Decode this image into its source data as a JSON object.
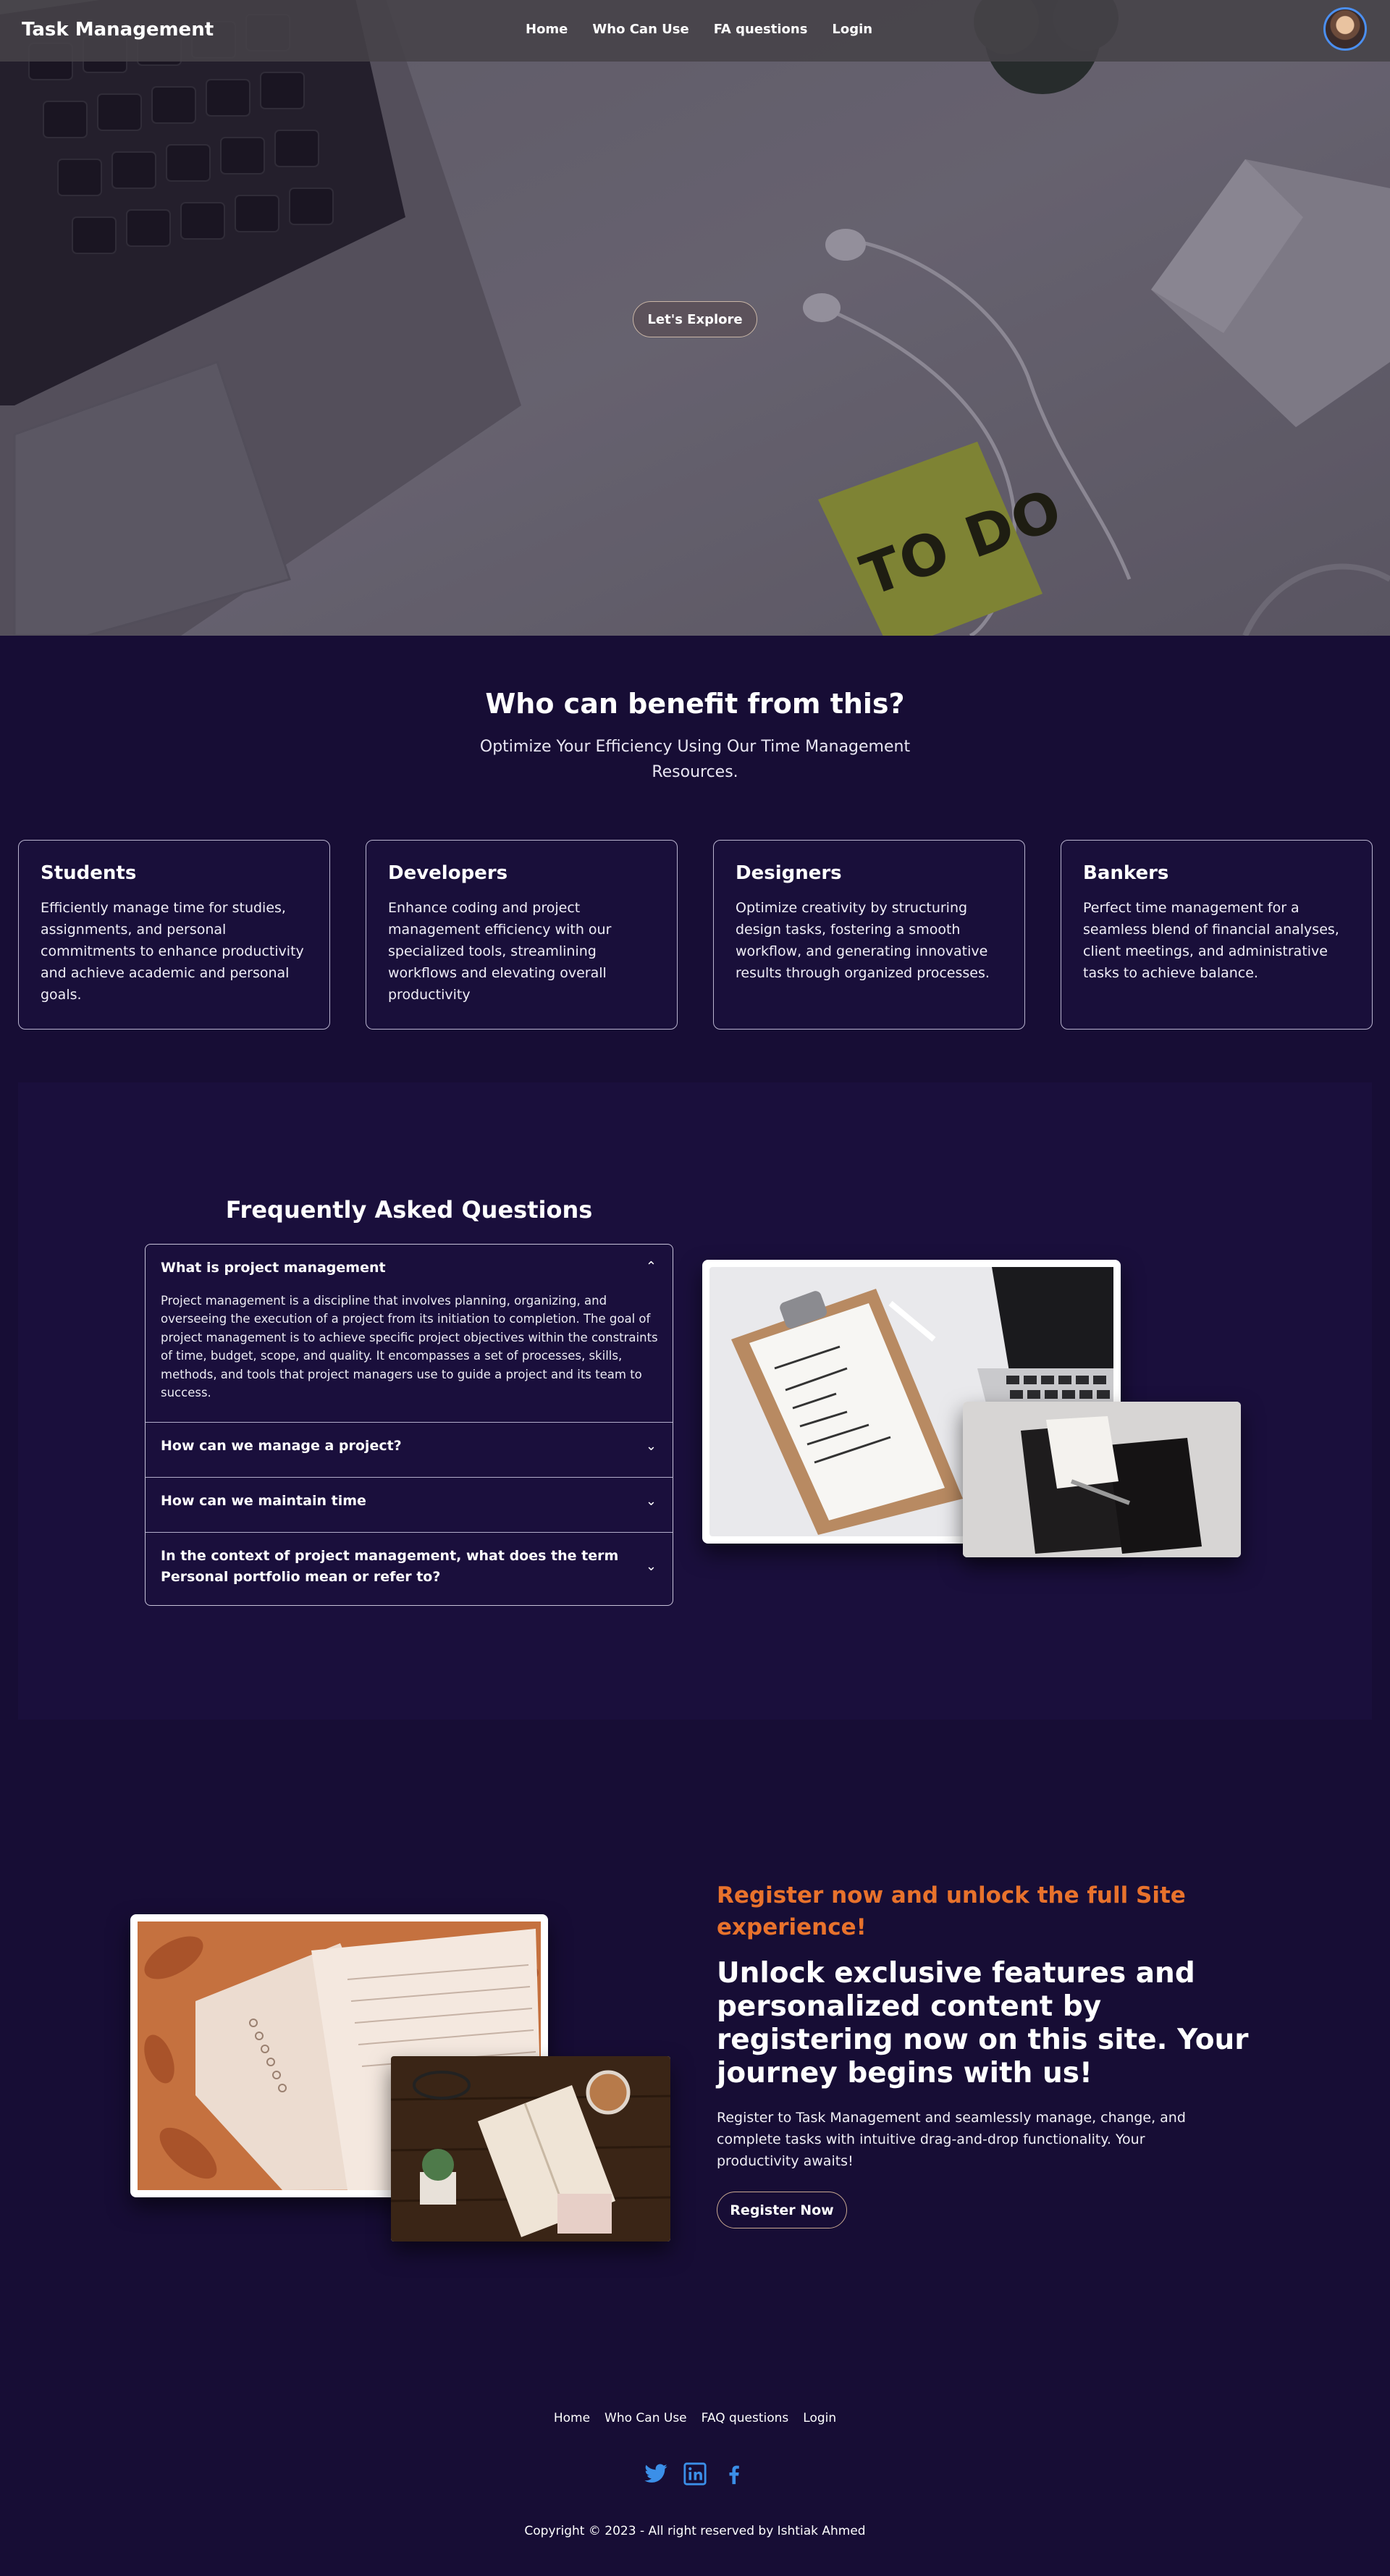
{
  "nav": {
    "brand": "Task Management",
    "links": [
      "Home",
      "Who Can Use",
      "FA questions",
      "Login"
    ]
  },
  "hero": {
    "explore_label": "Let's Explore",
    "sticky_note_text": "TO DO"
  },
  "benefits": {
    "title": "Who can benefit from this?",
    "subtitle": "Optimize Your Efficiency Using Our Time Management Resources.",
    "cards": [
      {
        "title": "Students",
        "text": "Efficiently manage time for studies, assignments, and personal commitments to enhance productivity and achieve academic and personal goals."
      },
      {
        "title": "Developers",
        "text": "Enhance coding and project management efficiency with our specialized tools, streamlining workflows and elevating overall productivity"
      },
      {
        "title": "Designers",
        "text": "Optimize creativity by structuring design tasks, fostering a smooth workflow, and generating innovative results through organized processes."
      },
      {
        "title": "Bankers",
        "text": "Perfect time management for a seamless blend of financial analyses, client meetings, and administrative tasks to achieve balance."
      }
    ]
  },
  "faq": {
    "title": "Frequently Asked Questions",
    "items": [
      {
        "q": "What is project management",
        "a": "Project management is a discipline that involves planning, organizing, and overseeing the execution of a project from its initiation to completion. The goal of project management is to achieve specific project objectives within the constraints of time, budget, scope, and quality. It encompasses a set of processes, skills, methods, and tools that project managers use to guide a project and its team to success."
      },
      {
        "q": "How can we manage a project?",
        "a": ""
      },
      {
        "q": "How can we maintain time",
        "a": ""
      },
      {
        "q": "In the context of project management, what does the term Personal portfolio mean or refer to?",
        "a": ""
      }
    ]
  },
  "register": {
    "kicker": "Register now and unlock the full Site experience!",
    "title": "Unlock exclusive features and personalized content by registering now on this site. Your journey begins with us!",
    "body": "Register to Task Management and seamlessly manage, change, and complete tasks with intuitive drag-and-drop functionality. Your productivity awaits!",
    "button": "Register Now"
  },
  "footer": {
    "links": [
      "Home",
      "Who Can Use",
      "FAQ questions",
      "Login"
    ],
    "social": [
      "twitter-icon",
      "linkedin-icon",
      "facebook-icon"
    ],
    "copyright": "Copyright © 2023 - All right reserved by Ishtiak Ahmed"
  },
  "colors": {
    "page_bg": "#170d35",
    "accent_orange": "#e8722c",
    "social_blue": "#3b8fe8"
  }
}
